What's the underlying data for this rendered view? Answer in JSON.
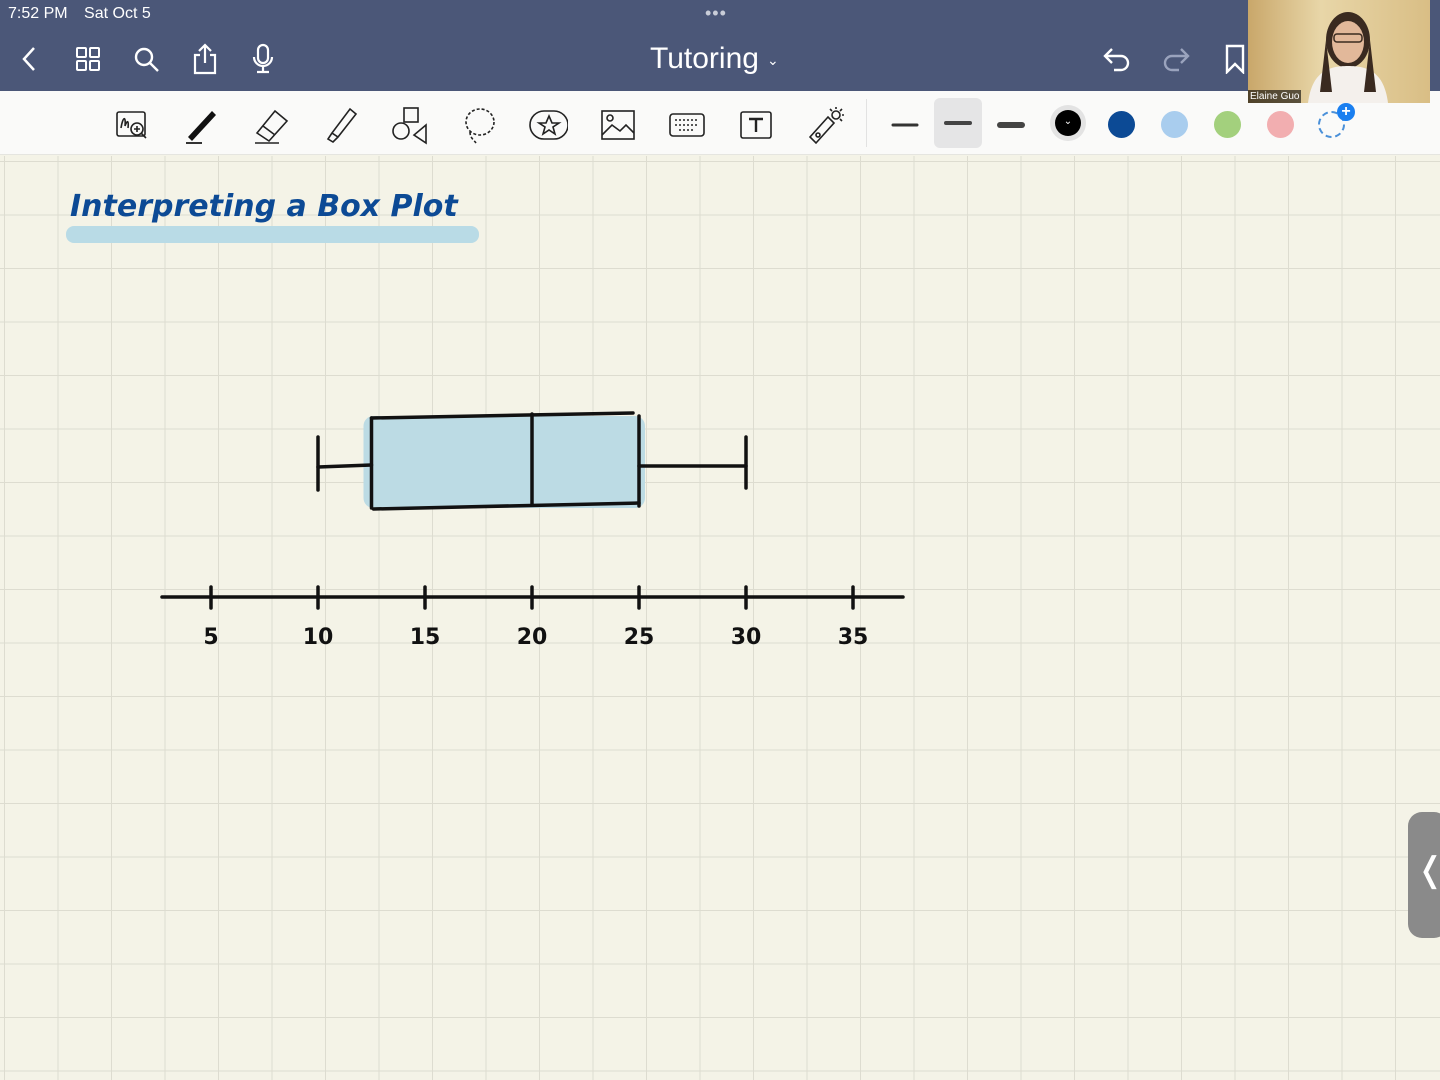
{
  "status_bar": {
    "time": "7:52 PM",
    "date": "Sat Oct 5",
    "more": "•••"
  },
  "nav": {
    "title": "Tutoring",
    "title_chevron": "⌄",
    "icons": [
      "back-icon",
      "grid-icon",
      "search-icon",
      "share-icon",
      "microphone-icon",
      "undo-icon",
      "redo-icon",
      "bookmark-icon"
    ]
  },
  "toolbar": {
    "tools": [
      "zoom-window",
      "pen",
      "eraser",
      "highlighter",
      "shapes",
      "lasso",
      "elements",
      "image",
      "keyboard",
      "text-box",
      "laser-pointer"
    ],
    "stroke_widths": [
      "thin",
      "medium",
      "thick"
    ],
    "selected_stroke": "medium",
    "colors": [
      "#000000",
      "#0c4a95",
      "#a9cdee",
      "#a3d07d",
      "#f2aeb0"
    ],
    "selected_color": "#000000"
  },
  "video": {
    "participant_name": "Elaine Guo"
  },
  "note": {
    "heading": "Interpreting a Box Plot",
    "heading_color": "#0c4a95",
    "highlight_color": "#b9dbe6",
    "box_plot": {
      "min": 10,
      "q1": 12.5,
      "median": 20,
      "q3": 25,
      "max": 30,
      "fill": "#bcdbe4"
    },
    "axis": {
      "ticks": [
        "5",
        "10",
        "15",
        "20",
        "25",
        "30",
        "35"
      ]
    }
  },
  "side_tab": {
    "label": "❬"
  }
}
